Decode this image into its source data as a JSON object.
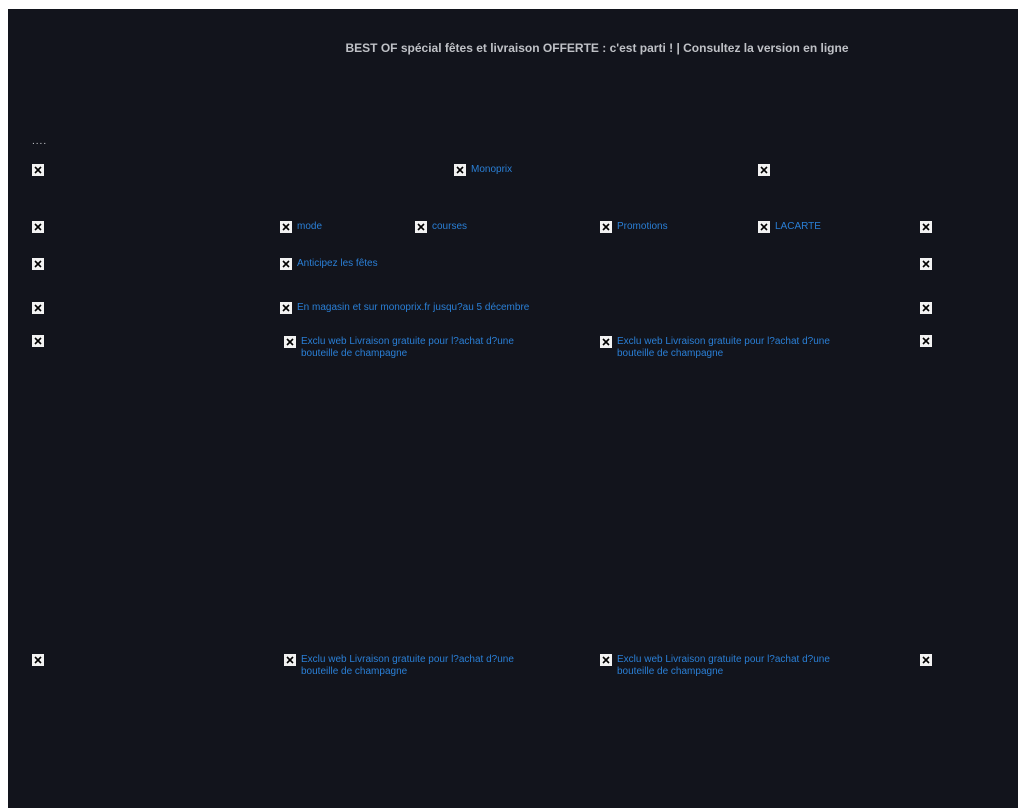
{
  "preheader": {
    "text": "BEST OF spécial fêtes et livraison OFFERTE : c'est parti ! | Consultez la version en ligne"
  },
  "placeholder_text": "....",
  "header": {
    "logo_link": "Monoprix"
  },
  "nav": {
    "items": [
      "mode",
      "courses",
      "Promotions",
      "LACARTE"
    ]
  },
  "promo": {
    "title": "Anticipez les fêtes",
    "subtitle": "En magasin et sur monoprix.fr jusqu?au 5 décembre"
  },
  "offers": {
    "text_line1": "Exclu web Livraison gratuite pour l?achat d?une",
    "text_line2": "bouteille de champagne"
  },
  "colors": {
    "background": "#12141c",
    "link": "#2a7fd6",
    "preheader_text": "#bfc1c6"
  }
}
